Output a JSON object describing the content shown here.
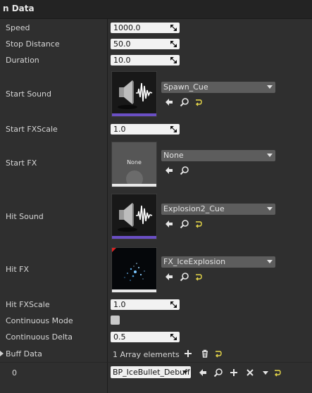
{
  "section": {
    "title": "n Data"
  },
  "fields": {
    "speed": {
      "label": "Speed",
      "value": "1000.0"
    },
    "stop_distance": {
      "label": "Stop Distance",
      "value": "50.0"
    },
    "duration": {
      "label": "Duration",
      "value": "10.0"
    },
    "start_sound": {
      "label": "Start Sound",
      "asset": "Spawn_Cue"
    },
    "start_fx_scale": {
      "label": "Start FXScale",
      "value": "1.0"
    },
    "start_fx": {
      "label": "Start FX",
      "asset": "None",
      "thumb_text": "None"
    },
    "hit_sound": {
      "label": "Hit Sound",
      "asset": "Explosion2_Cue"
    },
    "hit_fx": {
      "label": "Hit FX",
      "asset": "FX_IceExplosion"
    },
    "hit_fx_scale": {
      "label": "Hit FXScale",
      "value": "1.0"
    },
    "continuous_mode": {
      "label": "Continuous Mode",
      "checked": false
    },
    "continuous_delta": {
      "label": "Continuous Delta",
      "value": "0.5"
    },
    "buff_data": {
      "label": "Buff Data",
      "count_text": "1 Array elements"
    },
    "buff_element": {
      "index": "0",
      "value": "BP_IceBullet_Debuff"
    }
  },
  "icons": {
    "use": "arrow-left-icon",
    "browse": "magnifier-icon",
    "reset": "reset-arrow-icon",
    "add": "plus-icon",
    "delete": "trash-icon",
    "insert": "plus-icon",
    "remove": "x-icon",
    "more": "caret-down-icon"
  },
  "colors": {
    "background": "#2f2f2f",
    "header": "#232323",
    "sound_bar": "#6a4fc4",
    "fx_bar": "#e8e8e8",
    "reset": "#e7d84a"
  }
}
